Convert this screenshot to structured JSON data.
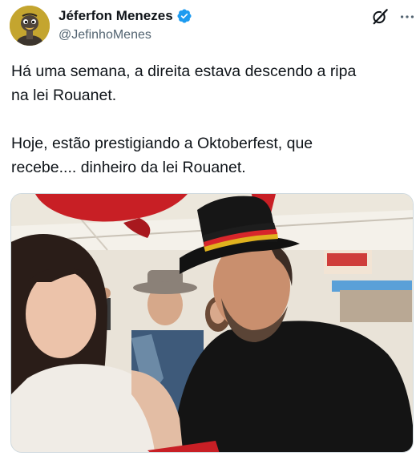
{
  "author": {
    "display_name": "Jéferfon Menezes",
    "handle": "@JefinhoMenes",
    "verified": true,
    "avatar_icon": "ostrich-avatar"
  },
  "post": {
    "text": "Há uma semana, a direita estava descendo a ripa\nna lei Rouanet.\n\nHoje, estão prestigiando a Oktoberfest, que\nrecebe.... dinheiro da lei Rouanet."
  },
  "actions": {
    "grok_icon": "grok-icon",
    "more_icon": "more-options-icon"
  },
  "colors": {
    "verified_blue": "#1d9bf0",
    "text_primary": "#0f1419",
    "text_secondary": "#536471"
  }
}
